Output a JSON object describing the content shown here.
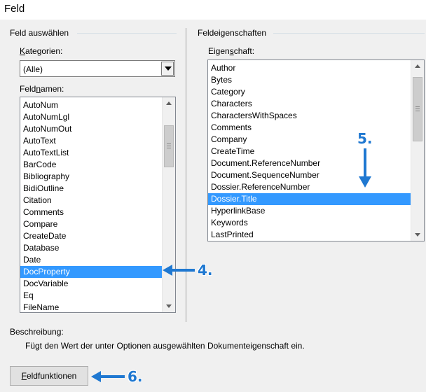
{
  "window": {
    "title": "Feld"
  },
  "left": {
    "group_title": "Feld auswählen",
    "categories": {
      "label_accel": "K",
      "label_rest": "ategorien:",
      "value": "(Alle)"
    },
    "fieldnames": {
      "label_pre": "Feld",
      "label_accel": "n",
      "label_post": "amen:",
      "items": [
        "AutoNum",
        "AutoNumLgl",
        "AutoNumOut",
        "AutoText",
        "AutoTextList",
        "BarCode",
        "Bibliography",
        "BidiOutline",
        "Citation",
        "Comments",
        "Compare",
        "CreateDate",
        "Database",
        "Date",
        "DocProperty",
        "DocVariable",
        "Eq",
        "FileName"
      ],
      "selected": "DocProperty"
    }
  },
  "right": {
    "group_title": "Feldeigenschaften",
    "property": {
      "label_pre": "Eigen",
      "label_accel": "s",
      "label_post": "chaft:",
      "items": [
        "Author",
        "Bytes",
        "Category",
        "Characters",
        "CharactersWithSpaces",
        "Comments",
        "Company",
        "CreateTime",
        "Document.ReferenceNumber",
        "Document.SequenceNumber",
        "Dossier.ReferenceNumber",
        "Dossier.Title",
        "HyperlinkBase",
        "Keywords",
        "LastPrinted"
      ],
      "selected": "Dossier.Title"
    }
  },
  "description": {
    "label": "Beschreibung:",
    "text": "Fügt den Wert der unter Optionen ausgewählten Dokumenteigenschaft ein."
  },
  "buttons": {
    "field_codes_accel": "F",
    "field_codes_rest": "eldfunktionen"
  },
  "annotations": {
    "step4": "4.",
    "step5": "5.",
    "step6": "6.",
    "color": "#1f78d1"
  },
  "colors": {
    "selection": "#3399ff",
    "background": "#f0f0f0"
  }
}
